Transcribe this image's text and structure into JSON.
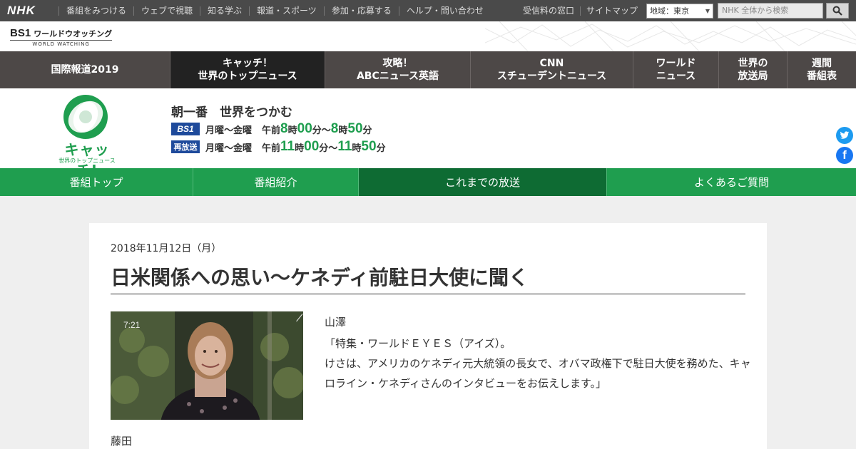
{
  "nhk_bar": {
    "logo": "NHK",
    "links": [
      "番組をみつける",
      "ウェブで視聴",
      "知る学ぶ",
      "報道・スポーツ",
      "参加・応募する",
      "ヘルプ・問い合わせ"
    ],
    "right_links": [
      "受信料の窓口",
      "サイトマップ"
    ],
    "region_label": "地域：",
    "region_value": "東京",
    "search_placeholder": "NHK 全体から検索"
  },
  "bs1": {
    "logo_main": "BS1",
    "logo_title": "ワールドウオッチング",
    "logo_sub": "WORLD WATCHING"
  },
  "program_nav": [
    {
      "label": "国際報道2019"
    },
    {
      "label": "キャッチ！\n世界のトップニュース"
    },
    {
      "label": "攻略！\nABCニュース英語"
    },
    {
      "label": "CNN\nスチューデントニュース"
    },
    {
      "label": "ワールド\nニュース"
    },
    {
      "label": "世界の\n放送局"
    },
    {
      "label": "週間\n番組表"
    }
  ],
  "program": {
    "logo_text": "キャッチ!",
    "logo_sub": "世界のトップニュース",
    "tagline": "朝一番　世界をつかむ",
    "schedules": [
      {
        "badge": "BS1",
        "days": "月曜～金曜",
        "ampm": "午前",
        "h1": "8",
        "m1": "00",
        "h2": "8",
        "m2": "50"
      },
      {
        "badge": "再放送",
        "days": "月曜～金曜",
        "ampm": "午前",
        "h1": "11",
        "m1": "00",
        "h2": "11",
        "m2": "50"
      }
    ],
    "unit_hour": "時",
    "unit_min": "分",
    "tilde": "～"
  },
  "green_nav": [
    "番組トップ",
    "番組紹介",
    "これまでの放送",
    "よくあるご質問"
  ],
  "article": {
    "date": "2018年11月12日（月）",
    "title": "日米関係への思い～ケネディ前駐日大使に聞く",
    "thumb_timecode": "7:21",
    "speaker1": "山澤",
    "para": "「特集・ワールドＥＹＥＳ（アイズ）。\nけさは、アメリカのケネディ元大統領の長女で、オバマ政権下で駐日大使を務めた、キャロライン・ケネディさんのインタビューをお伝えします。」",
    "speaker2": "藤田"
  },
  "colors": {
    "green": "#1f9e4f",
    "dark_green": "#0e6b33",
    "nav_dark": "#4d4847",
    "bs1_blue": "#1e4a9b"
  }
}
